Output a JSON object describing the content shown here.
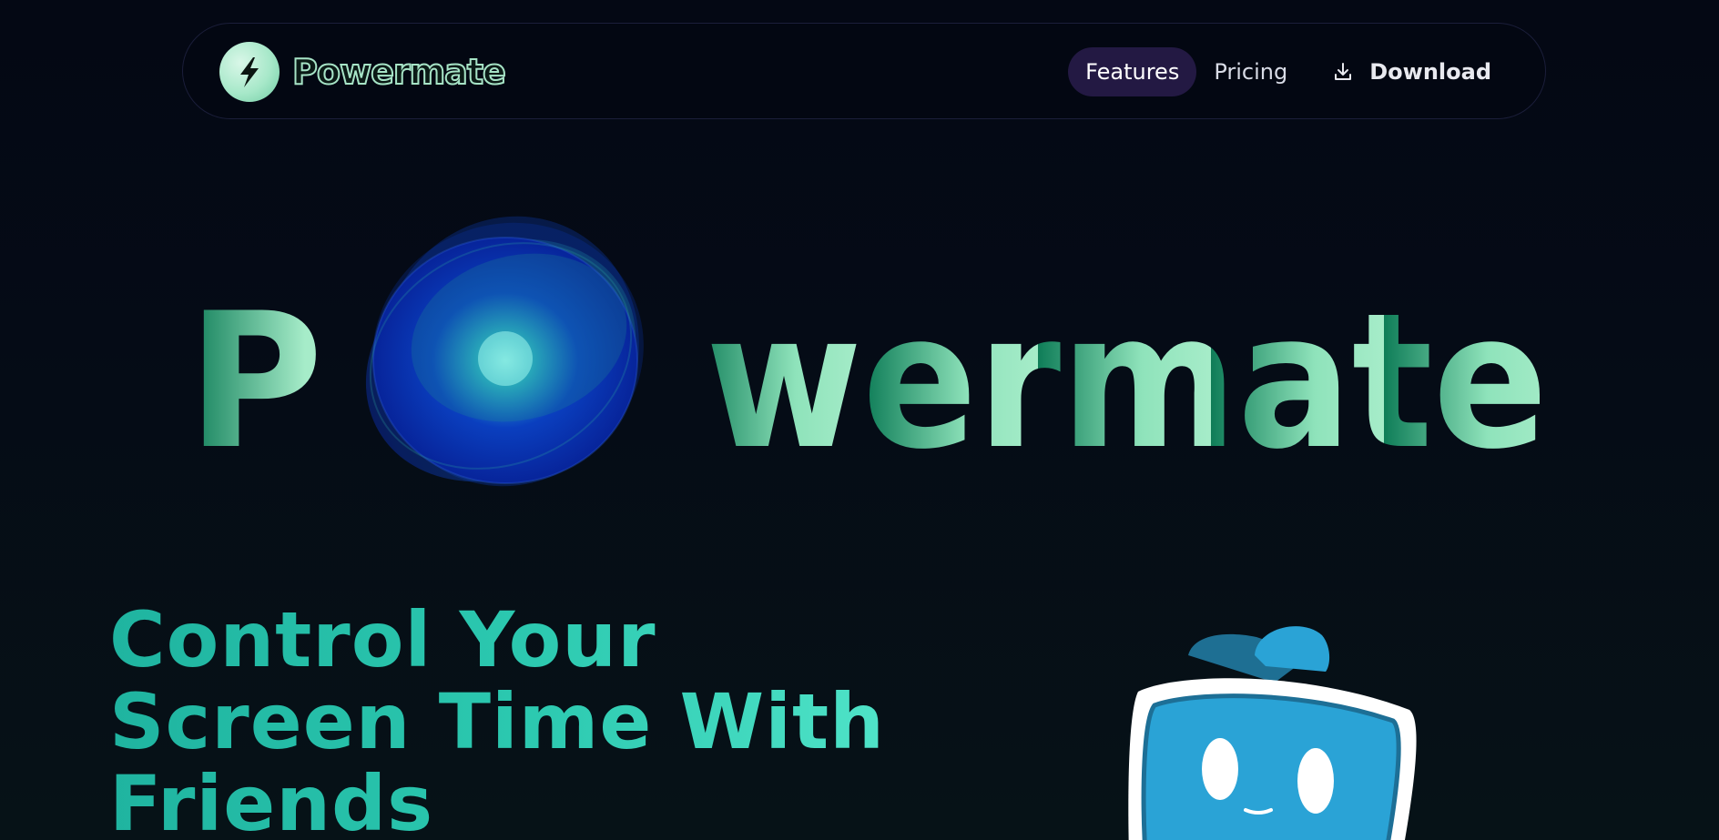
{
  "brand": {
    "name": "Powermate",
    "logo_icon": "lightning-bolt-icon"
  },
  "nav": {
    "items": [
      {
        "label": "Features",
        "active": true
      },
      {
        "label": "Pricing",
        "active": false
      }
    ],
    "download": {
      "label": "Download",
      "icon": "download-icon"
    }
  },
  "hero": {
    "wordmark_prefix": "P",
    "wordmark_suffix": "wermate",
    "headline_lines": [
      "Control Your",
      "Screen Time With",
      "Friends"
    ]
  },
  "colors": {
    "background": "#050914",
    "nav_active": "#231943",
    "wordmark_light": "#9ee8c4",
    "wordmark_dark": "#0f7d58",
    "headline_teal": "#2cc9b0",
    "mascot_blue": "#2aa3d6"
  }
}
